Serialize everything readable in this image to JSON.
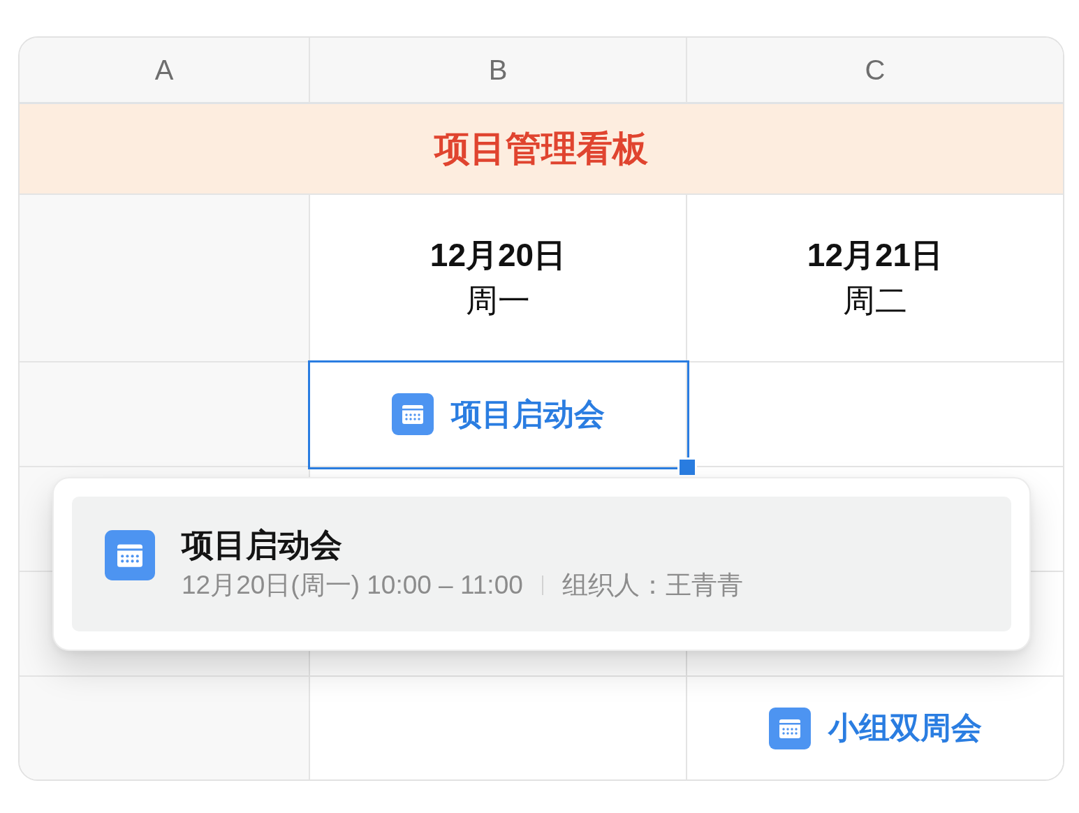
{
  "sheet": {
    "columns": [
      {
        "label": "A"
      },
      {
        "label": "B"
      },
      {
        "label": "C"
      }
    ],
    "title": "项目管理看板",
    "rows": [
      {
        "cells": [
          {
            "kind": "blank",
            "selected": false
          },
          {
            "kind": "date",
            "date": "12月20日",
            "weekday": "周一",
            "selected": false
          },
          {
            "kind": "date",
            "date": "12月21日",
            "weekday": "周二",
            "selected": false
          }
        ]
      },
      {
        "cells": [
          {
            "kind": "blank",
            "selected": false
          },
          {
            "kind": "event",
            "title": "项目启动会",
            "selected": true
          },
          {
            "kind": "blank",
            "selected": false
          }
        ]
      },
      {
        "cells": [
          {
            "kind": "blank",
            "selected": false
          },
          {
            "kind": "blank",
            "selected": false
          },
          {
            "kind": "blank",
            "selected": false
          }
        ]
      },
      {
        "cells": [
          {
            "kind": "blank",
            "selected": false
          },
          {
            "kind": "blank",
            "selected": false
          },
          {
            "kind": "blank",
            "selected": false
          }
        ]
      },
      {
        "cells": [
          {
            "kind": "blank",
            "selected": false
          },
          {
            "kind": "blank",
            "selected": false
          },
          {
            "kind": "event",
            "title": "小组双周会",
            "selected": false
          }
        ]
      }
    ]
  },
  "event_popup": {
    "title": "项目启动会",
    "time": "12月20日(周一) 10:00 – 11:00",
    "organizer": "组织人：王青青"
  }
}
